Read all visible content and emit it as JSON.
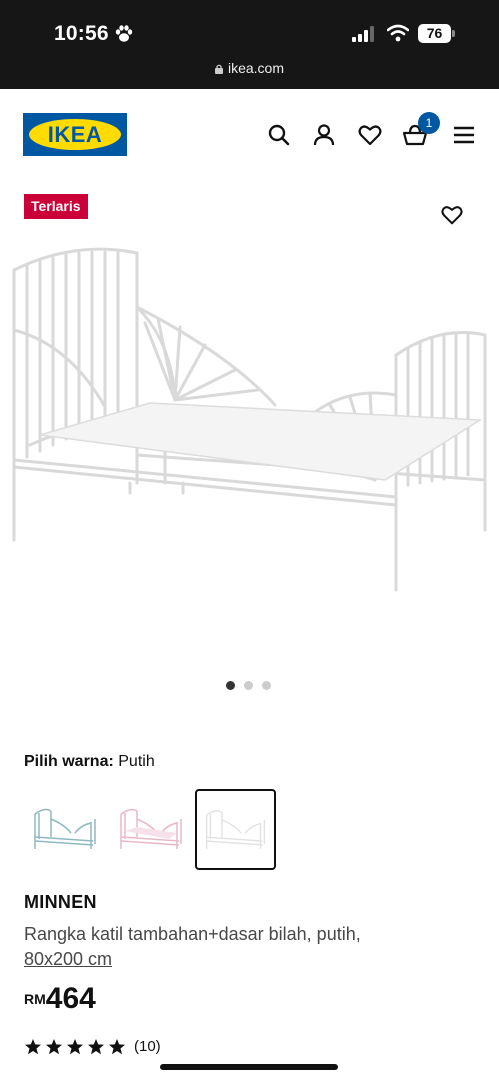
{
  "status_bar": {
    "time": "10:56",
    "battery": "76",
    "url": "ikea.com"
  },
  "header": {
    "logo_text": "IKEA",
    "cart_count": "1"
  },
  "product": {
    "badge": "Terlaris",
    "color_label": "Pilih warna:",
    "color_value": "Putih",
    "swatches": [
      "blue",
      "pink",
      "white"
    ],
    "selected_swatch": 2,
    "gallery_dots": 3,
    "gallery_active": 0,
    "name": "MINNEN",
    "description": "Rangka katil tambahan+dasar bilah, putih,",
    "size": "80x200 cm",
    "currency": "RM",
    "price": "464",
    "rating": 5,
    "reviews": "(10)"
  },
  "colors": {
    "ikea_blue": "#0058a3",
    "ikea_yellow": "#ffdb00",
    "badge_red": "#cc0038"
  },
  "icons": [
    "search-icon",
    "user-icon",
    "heart-icon",
    "cart-icon",
    "menu-icon"
  ]
}
